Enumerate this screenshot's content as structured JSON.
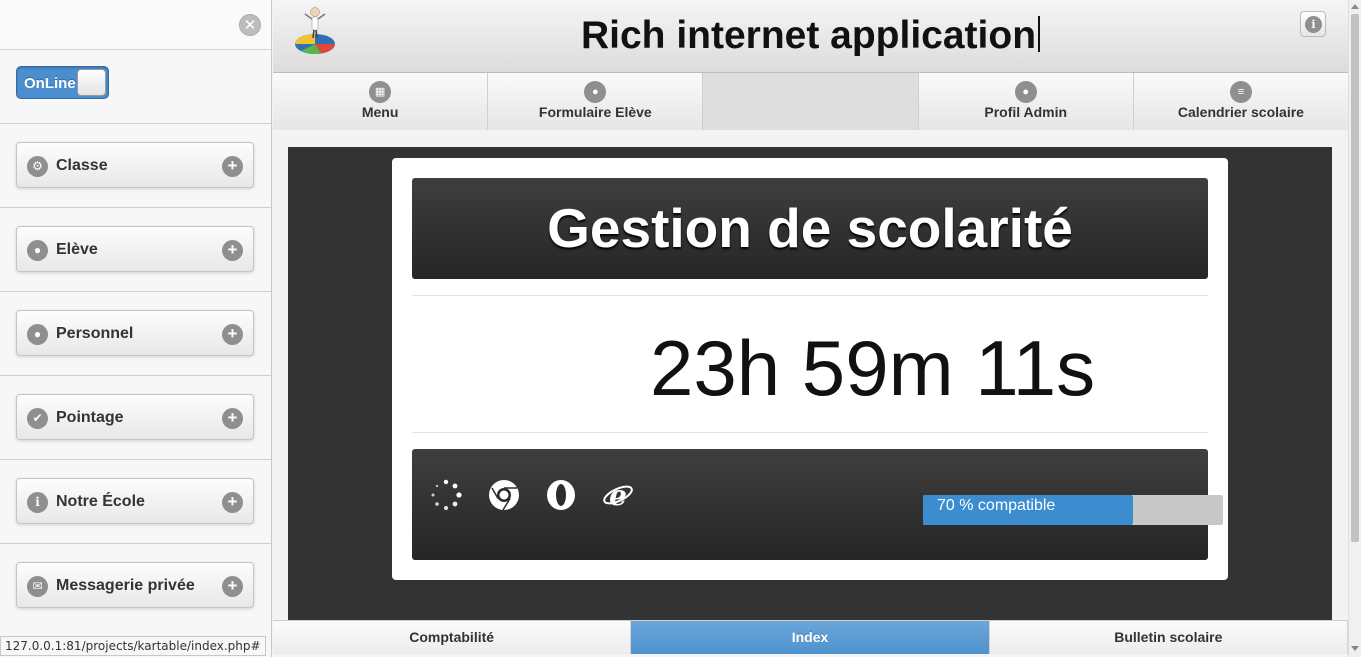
{
  "header": {
    "title": "Rich internet application",
    "logo_icon": "pie-chart-figure-icon",
    "info_icon": "info-icon"
  },
  "left_panel": {
    "close_icon": "close-icon",
    "toggle": {
      "label": "OnLine",
      "state": "on"
    },
    "nav_items": [
      {
        "label": "Classe",
        "icon": "gear-icon"
      },
      {
        "label": "Elève",
        "icon": "user-icon"
      },
      {
        "label": "Personnel",
        "icon": "user-icon"
      },
      {
        "label": "Pointage",
        "icon": "check-icon"
      },
      {
        "label": "Notre École",
        "icon": "info-icon"
      },
      {
        "label": "Messagerie privée",
        "icon": "mail-icon"
      }
    ]
  },
  "top_tabs": [
    {
      "label": "Menu",
      "icon": "grid-icon"
    },
    {
      "label": "Formulaire Elève",
      "icon": "user-icon"
    },
    {
      "label": "",
      "icon": ""
    },
    {
      "label": "Profil Admin",
      "icon": "user-icon"
    },
    {
      "label": "Calendrier scolaire",
      "icon": "list-icon"
    }
  ],
  "main": {
    "banner_title": "Gestion de scolarité",
    "countdown": "23h 59m 11s",
    "browsers": [
      "loading-spinner-icon",
      "chrome-icon",
      "opera-icon",
      "internet-explorer-icon"
    ],
    "compatibility": {
      "label": "70 % compatible",
      "percent": 70
    }
  },
  "bottom_tabs": [
    {
      "label": "Comptabilité",
      "active": false
    },
    {
      "label": "Index",
      "active": true
    },
    {
      "label": "Bulletin scolaire",
      "active": false
    }
  ],
  "status_url": "127.0.0.1:81/projects/kartable/index.php#",
  "colors": {
    "accent": "#4b8ed0",
    "dark_panel": "#333333",
    "progress_fill": "#3b8dd0"
  }
}
